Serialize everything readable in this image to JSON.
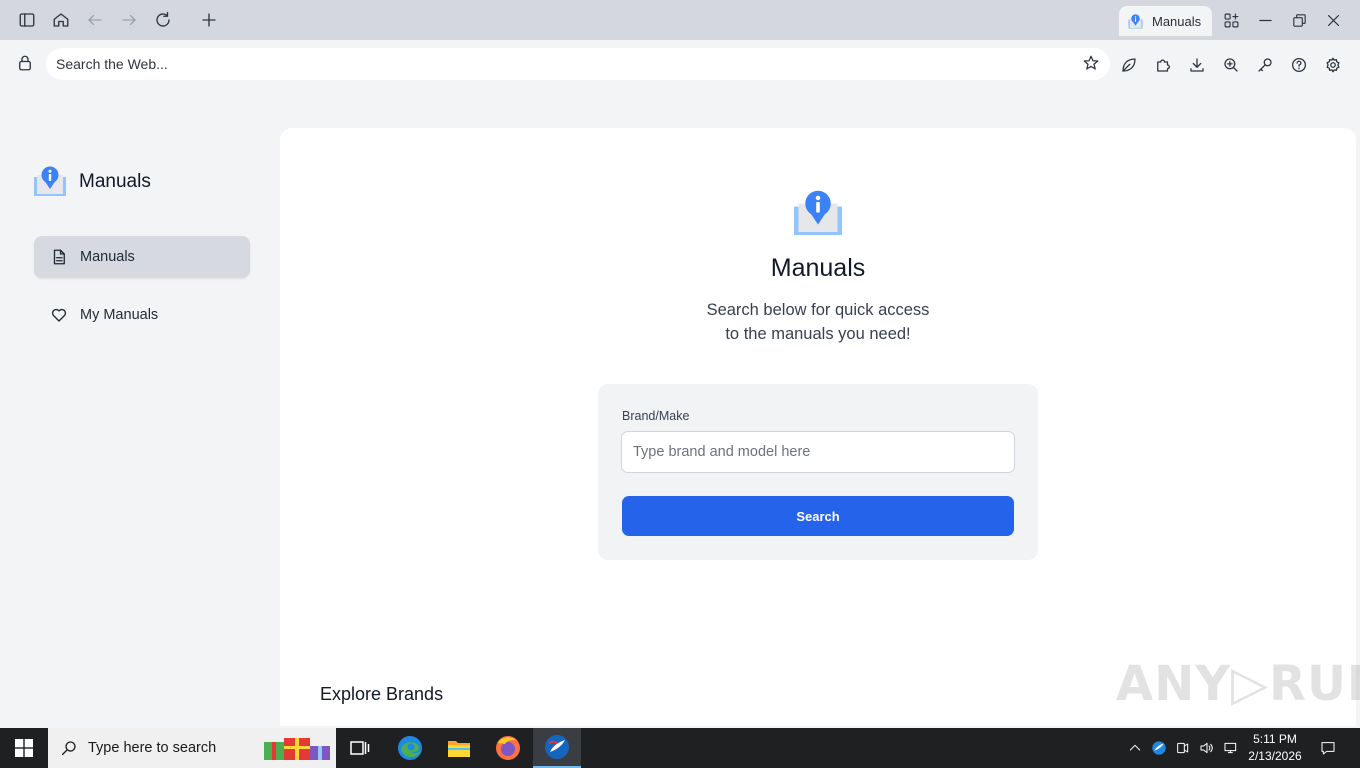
{
  "browser": {
    "tab": {
      "label": "Manuals"
    },
    "address_bar": {
      "placeholder": "Search the Web..."
    }
  },
  "sidebar": {
    "brand_name": "Manuals",
    "items": [
      {
        "label": "Manuals",
        "icon": "document-icon",
        "active": true
      },
      {
        "label": "My Manuals",
        "icon": "heart-icon",
        "active": false
      }
    ]
  },
  "main": {
    "title": "Manuals",
    "subtitle_line1": "Search below for quick access",
    "subtitle_line2": "to the manuals you need!",
    "search_form": {
      "label": "Brand/Make",
      "placeholder": "Type brand and model here",
      "button_label": "Search"
    },
    "explore_heading": "Explore Brands"
  },
  "colors": {
    "accent": "#2563eb",
    "brand_icon": "#3b82f6"
  },
  "taskbar": {
    "search_placeholder": "Type here to search",
    "time": "5:11 PM",
    "date": "2/13/2026"
  }
}
